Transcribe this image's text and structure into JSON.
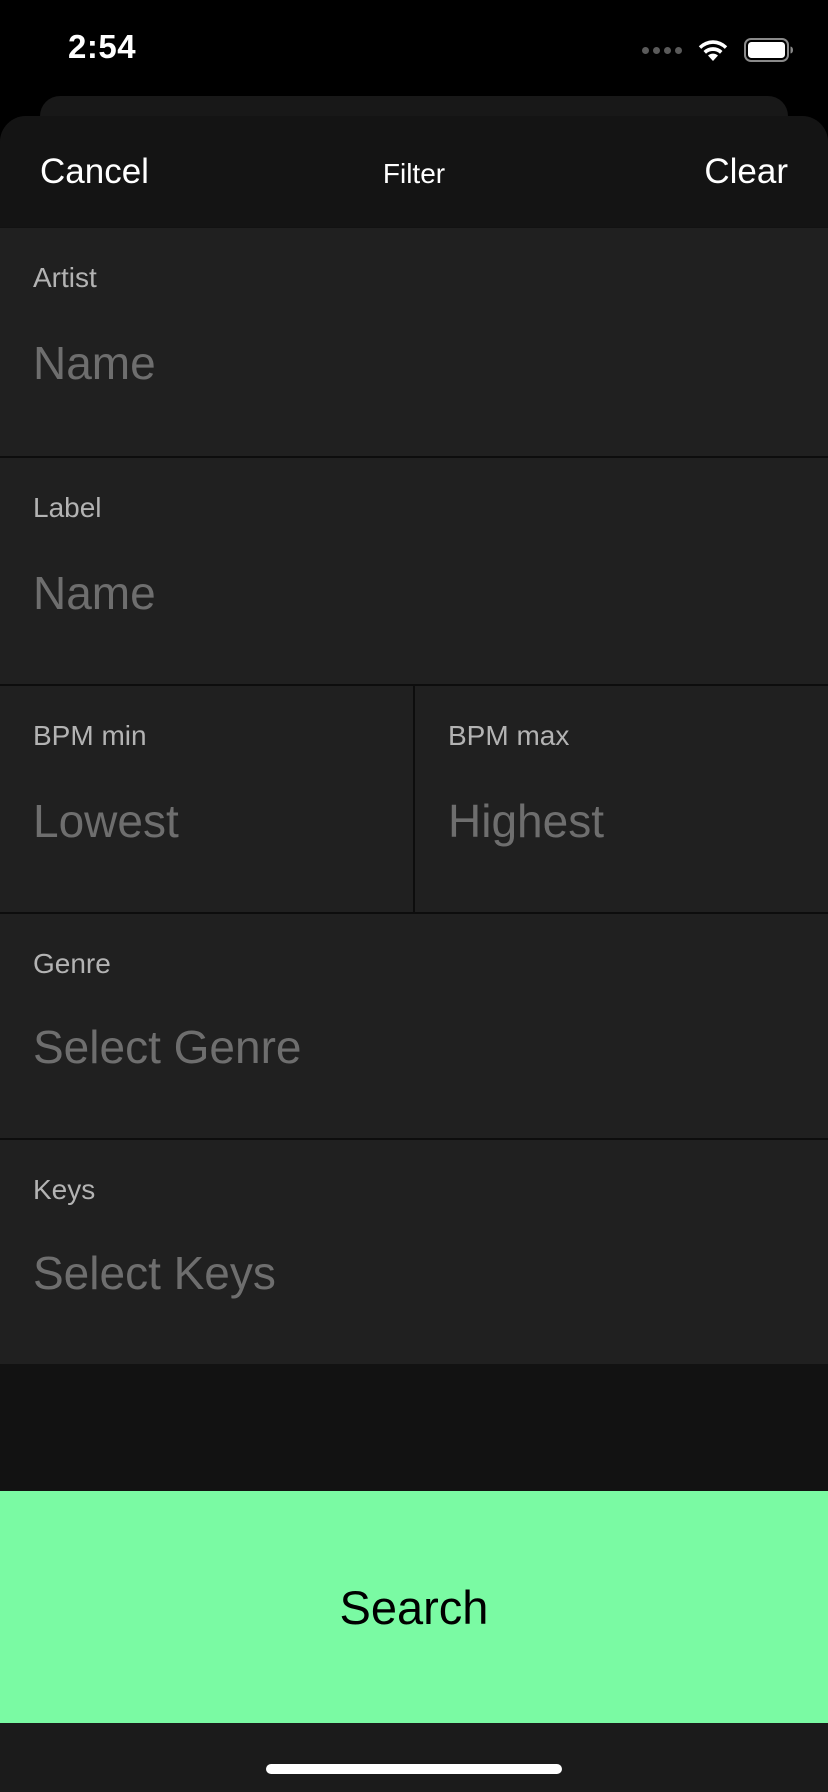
{
  "status_bar": {
    "time": "2:54"
  },
  "nav": {
    "cancel_label": "Cancel",
    "title": "Filter",
    "clear_label": "Clear"
  },
  "fields": {
    "artist": {
      "label": "Artist",
      "placeholder": "Name",
      "value": ""
    },
    "label": {
      "label": "Label",
      "placeholder": "Name",
      "value": ""
    },
    "bpm_min": {
      "label": "BPM min",
      "placeholder": "Lowest",
      "value": ""
    },
    "bpm_max": {
      "label": "BPM max",
      "placeholder": "Highest",
      "value": ""
    },
    "genre": {
      "label": "Genre",
      "placeholder": "Select Genre"
    },
    "keys": {
      "label": "Keys",
      "placeholder": "Select Keys"
    }
  },
  "search_label": "Search",
  "colors": {
    "accent": "#7afaa3",
    "field_background": "#202020",
    "placeholder": "#6e6e6e",
    "label": "#b3b3b3"
  },
  "icons": [
    "signal-icon",
    "wifi-icon",
    "battery-icon"
  ]
}
